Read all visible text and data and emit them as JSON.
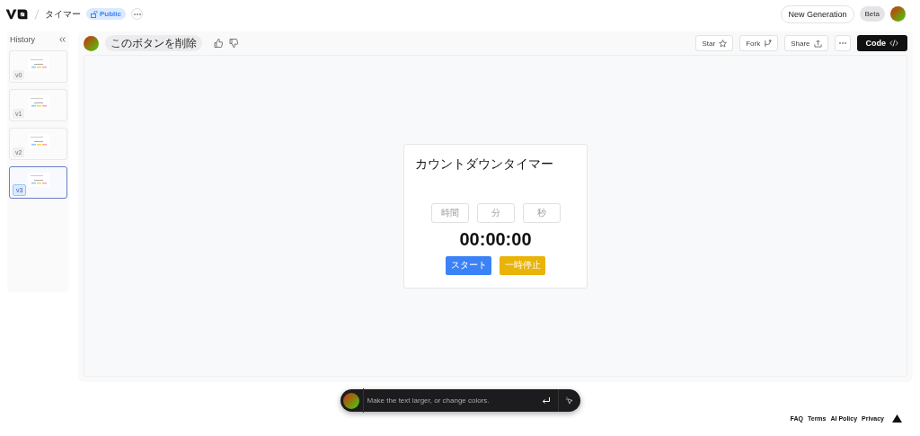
{
  "header": {
    "project": "タイマー",
    "visibility": "Public",
    "new_generation": "New Generation",
    "beta": "Beta"
  },
  "history": {
    "title": "History",
    "versions": [
      {
        "label": "v0",
        "selected": false
      },
      {
        "label": "v1",
        "selected": false
      },
      {
        "label": "v2",
        "selected": false
      },
      {
        "label": "v3",
        "selected": true
      }
    ]
  },
  "toolbar": {
    "message": "このボタンを削除",
    "actions": [
      {
        "label": "Star",
        "kind": "star"
      },
      {
        "label": "Fork",
        "kind": "fork"
      },
      {
        "label": "Share",
        "kind": "share"
      }
    ],
    "code": "Code"
  },
  "preview": {
    "title": "カウントダウンタイマー",
    "fields": [
      {
        "placeholder": "時間"
      },
      {
        "placeholder": "分"
      },
      {
        "placeholder": "秒"
      }
    ],
    "display": "00:00:00",
    "buttons": [
      {
        "label": "スタート",
        "kind": "start"
      },
      {
        "label": "一時停止",
        "kind": "pause"
      }
    ]
  },
  "prompt": {
    "placeholder": "Make the text larger, or change colors."
  },
  "footer": [
    "FAQ",
    "Terms",
    "AI Policy",
    "Privacy"
  ]
}
